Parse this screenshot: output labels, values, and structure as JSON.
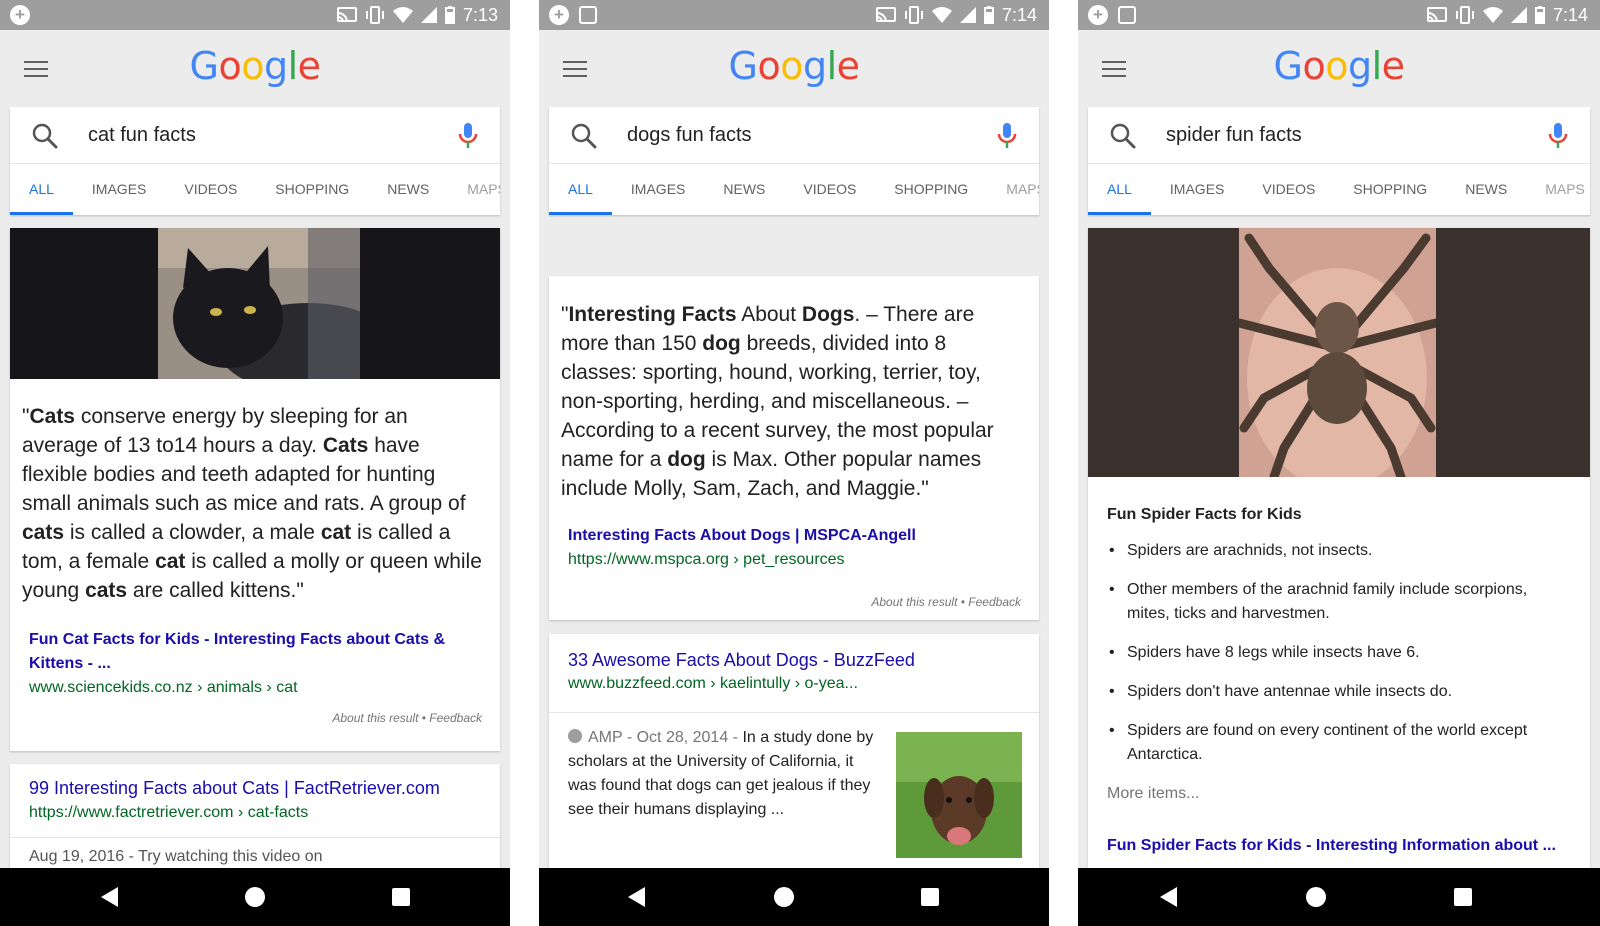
{
  "colors": {
    "accent": "#1a73e8",
    "link": "#1a0dab",
    "url": "#006621",
    "statusbar": "#9e9e9e"
  },
  "logo": {
    "letters": [
      "G",
      "o",
      "o",
      "g",
      "l",
      "e"
    ],
    "colors": [
      "#4285F4",
      "#EA4335",
      "#FBBC05",
      "#4285F4",
      "#34A853",
      "#EA4335"
    ]
  },
  "phone1": {
    "status_time": "7:13",
    "query": "cat fun facts",
    "tabs": [
      "ALL",
      "IMAGES",
      "VIDEOS",
      "SHOPPING",
      "NEWS",
      "MAPS"
    ],
    "snippet_html": "\"<b>Cats</b> conserve energy by sleeping for an average of 13 to14 hours a day. <b>Cats</b> have flexible bodies and teeth adapted for hunting small animals such as mice and rats. A group of <b>cats</b> is called a clowder, a male <b>cat</b> is called a tom, a female <b>cat</b> is called a molly or queen while young <b>cats</b> are called kittens.\"",
    "source_title": "Fun Cat Facts for Kids - Interesting Facts about Cats & Kittens - ...",
    "source_url": "www.sciencekids.co.nz › animals › cat",
    "about": "About this result • Feedback",
    "result2_title": "99 Interesting Facts about Cats | FactRetriever.com",
    "result2_url": "https://www.factretriever.com › cat-facts",
    "result3_partial": "Aug 19, 2016 - Try watching this video on"
  },
  "phone2": {
    "status_time": "7:14",
    "query": "dogs fun facts",
    "tabs": [
      "ALL",
      "IMAGES",
      "NEWS",
      "VIDEOS",
      "SHOPPING",
      "MAPS"
    ],
    "snippet_html": "\"<b>Interesting Facts</b> About <b>Dogs</b>. – There are more than 150 <b>dog</b> breeds, divided into 8 classes: sporting, hound, working, terrier, toy, non-sporting, herding, and miscellaneous. – According to a recent survey, the most popular name for a <b>dog</b> is Max. Other popular names include Molly, Sam, Zach, and Maggie.\"",
    "source_title": "Interesting Facts About Dogs | MSPCA-Angell",
    "source_url": "https://www.mspca.org › pet_resources",
    "about": "About this result • Feedback",
    "result2_title": "33 Awesome Facts About Dogs - BuzzFeed",
    "result2_url": "www.buzzfeed.com › kaelintully › o-yea...",
    "amp_label": "AMP",
    "amp_date": " - Oct 28, 2014 - ",
    "amp_text": "In a study done by scholars at the University of California, it was found that dogs can get jealous if they see their humans displaying ..."
  },
  "phone3": {
    "status_time": "7:14",
    "query": "spider fun facts",
    "tabs": [
      "ALL",
      "IMAGES",
      "VIDEOS",
      "SHOPPING",
      "NEWS",
      "MAPS"
    ],
    "list_title": "Fun Spider Facts for Kids",
    "facts": [
      "Spiders are arachnids, not insects.",
      "Other members of the arachnid family include scorpions, mites, ticks and harvestmen.",
      "Spiders have 8 legs while insects have 6.",
      "Spiders don't have antennae while insects do.",
      "Spiders are found on every continent of the world except Antarctica."
    ],
    "more_items": "More items...",
    "source_partial": "Fun Spider Facts for Kids - Interesting Information about ..."
  }
}
